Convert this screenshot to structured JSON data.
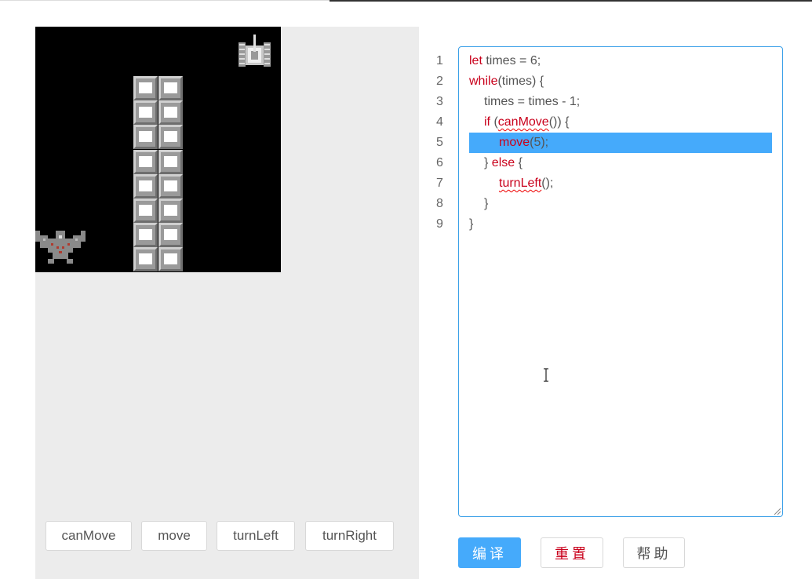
{
  "code_editor": {
    "line_numbers": [
      "1",
      "2",
      "3",
      "4",
      "5",
      "6",
      "7",
      "8",
      "9"
    ],
    "lines": {
      "l1_kw": "let",
      "l1_rest": " times = 6;",
      "l2_kw": "while",
      "l2_rest": "(times) {",
      "l3_text": "times = times - 1;",
      "l4_kw": "if",
      "l4_open": " (",
      "l4_fn": "canMove",
      "l4_rest": "()) {",
      "l5_fn": "move",
      "l5_rest": "(5);",
      "l6_open": "} ",
      "l6_kw": "else",
      "l6_rest": " {",
      "l7_fn": "turnLeft",
      "l7_rest": "();",
      "l8_text": "}",
      "l9_text": "}"
    },
    "highlighted_line": "5",
    "highlight_color": "#45aafb"
  },
  "commands": {
    "can_move": "canMove",
    "move": "move",
    "turn_left": "turnLeft",
    "turn_right": "turnRight"
  },
  "actions": {
    "compile": "编译",
    "reset": "重置",
    "help": "帮助"
  },
  "colors": {
    "accent": "#45aafb",
    "keyword": "#c9001b",
    "panel_bg": "#ececec",
    "editor_border": "#3ba0e8"
  },
  "game": {
    "icons": [
      "tank-icon",
      "eagle-icon",
      "brick-wall"
    ]
  }
}
